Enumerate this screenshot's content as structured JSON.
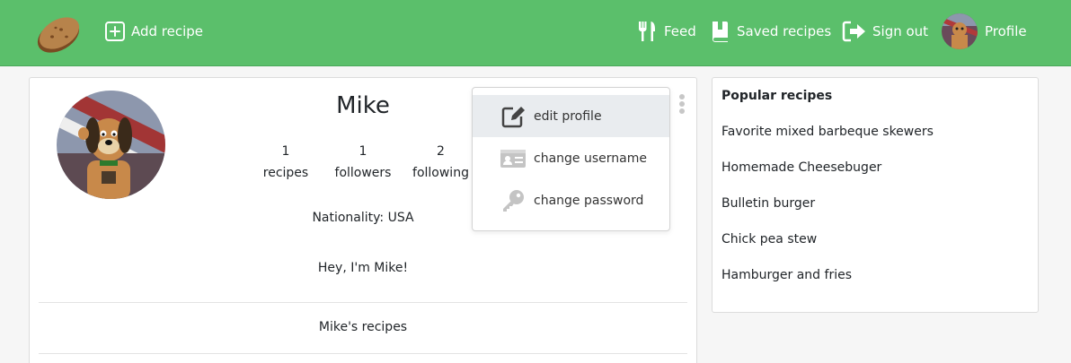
{
  "navbar": {
    "add_recipe": "Add recipe",
    "feed": "Feed",
    "saved_recipes": "Saved recipes",
    "sign_out": "Sign out",
    "profile": "Profile"
  },
  "profile": {
    "name": "Mike",
    "stats": [
      {
        "value": "1",
        "label": "recipes"
      },
      {
        "value": "1",
        "label": "followers"
      },
      {
        "value": "2",
        "label": "following"
      }
    ],
    "nationality": "Nationality: USA",
    "bio": "Hey, I'm Mike!",
    "recipes_tab": "Mike's recipes"
  },
  "menu": {
    "items": [
      {
        "label": "edit profile",
        "icon": "edit-icon"
      },
      {
        "label": "change username",
        "icon": "id-card-icon"
      },
      {
        "label": "change password",
        "icon": "key-icon"
      }
    ]
  },
  "sidebar": {
    "title": "Popular recipes",
    "items": [
      "Favorite mixed barbeque skewers",
      "Homemade Cheesebuger",
      "Bulletin burger",
      "Chick pea stew",
      "Hamburger and fries"
    ]
  },
  "colors": {
    "navbar": "#5bbf6b",
    "icon_gray": "#b5b5b5"
  }
}
